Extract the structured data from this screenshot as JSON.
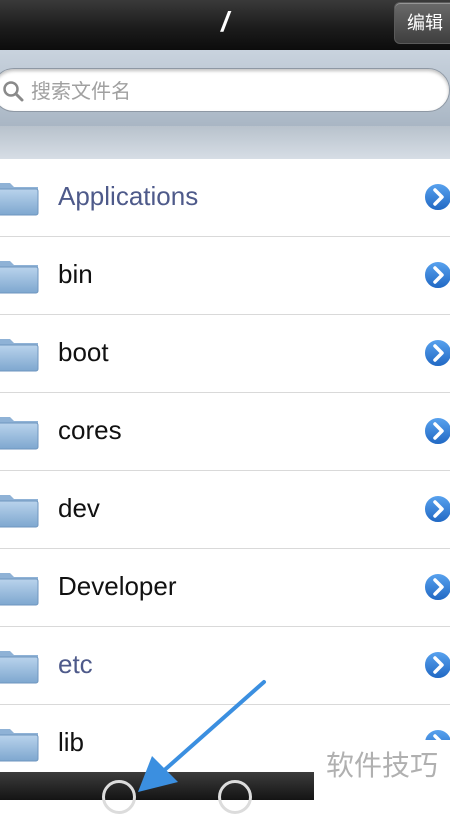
{
  "navbar": {
    "title": "/",
    "edit_label": "编辑"
  },
  "search": {
    "placeholder": "搜索文件名"
  },
  "files": [
    {
      "name": "Applications",
      "highlight": true
    },
    {
      "name": "bin",
      "highlight": false
    },
    {
      "name": "boot",
      "highlight": false
    },
    {
      "name": "cores",
      "highlight": false
    },
    {
      "name": "dev",
      "highlight": false
    },
    {
      "name": "Developer",
      "highlight": false
    },
    {
      "name": "etc",
      "highlight": true
    },
    {
      "name": "lib",
      "highlight": false
    }
  ],
  "colors": {
    "accent": "#2f7fd6",
    "highlight_text": "#4e5a8a",
    "arrow": "#3b8fe0"
  },
  "icons": {
    "row_folder": "folder-icon",
    "row_disclosure": "disclosure-button-icon"
  },
  "watermark": "软件技巧"
}
